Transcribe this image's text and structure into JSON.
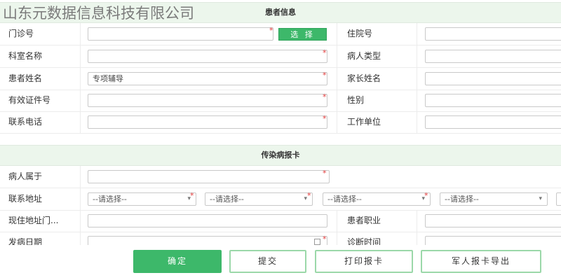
{
  "watermark": "山东元数据信息科技有限公司",
  "patient_section": {
    "title": "患者信息"
  },
  "fields": {
    "clinic_no": {
      "label": "门诊号",
      "value": ""
    },
    "select_button": "选 择",
    "inpatient_no": {
      "label": "住院号",
      "value": ""
    },
    "department": {
      "label": "科室名称",
      "value": ""
    },
    "patient_type": {
      "label": "病人类型",
      "value": ""
    },
    "patient_name": {
      "label": "患者姓名",
      "value": "专项辅导"
    },
    "guardian_name": {
      "label": "家长姓名",
      "value": ""
    },
    "id_doc_no": {
      "label": "有效证件号",
      "value": ""
    },
    "gender": {
      "label": "性别",
      "value": ""
    },
    "phone": {
      "label": "联系电话",
      "value": ""
    },
    "work_unit": {
      "label": "工作单位",
      "value": ""
    }
  },
  "infectious_section": {
    "title": "传染病报卡"
  },
  "infectious": {
    "belongs_to": {
      "label": "病人属于",
      "value": ""
    },
    "address": {
      "label": "联系地址",
      "select1": "--请选择--",
      "select2": "--请选择--",
      "select3": "--请选择--",
      "select4": "--请选择--"
    },
    "current_address": {
      "label": "现住地址门...",
      "value": ""
    },
    "occupation": {
      "label": "患者职业",
      "value": ""
    },
    "onset_date": {
      "label": "发病日期",
      "value": ""
    },
    "diagnosis_time": {
      "label": "诊断时间",
      "value": ""
    }
  },
  "required_mark": "*",
  "footer": {
    "confirm": "确定",
    "submit": "提交",
    "print": "打印报卡",
    "export": "军人报卡导出"
  },
  "colors": {
    "accent": "#3db86a",
    "section_bg": "#ecf6ec",
    "required": "#e23a3a"
  }
}
